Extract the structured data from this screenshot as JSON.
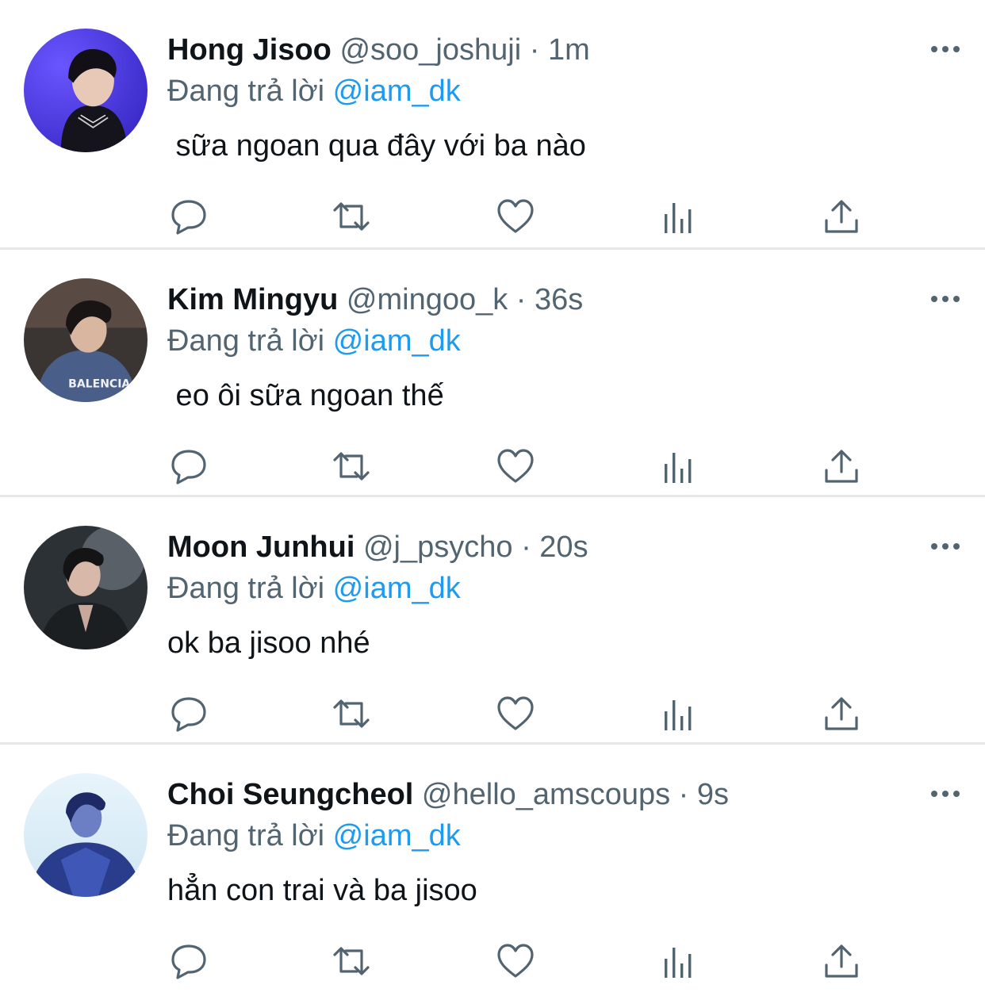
{
  "tweets": [
    {
      "name": "Hong Jisoo",
      "handle": "@soo_joshuji",
      "separator": "·",
      "time": "1m",
      "replying_prefix": "Đang trả lời",
      "replying_to": "@iam_dk",
      "text": " sữa ngoan qua đây với ba nào"
    },
    {
      "name": "Kim Mingyu",
      "handle": "@mingoo_k",
      "separator": "·",
      "time": "36s",
      "replying_prefix": "Đang trả lời",
      "replying_to": "@iam_dk",
      "text": " eo ôi sữa ngoan thế"
    },
    {
      "name": "Moon Junhui",
      "handle": "@j_psycho",
      "separator": "·",
      "time": "20s",
      "replying_prefix": "Đang trả lời",
      "replying_to": "@iam_dk",
      "text": "ok ba jisoo nhé"
    },
    {
      "name": "Choi Seungcheol",
      "handle": "@hello_amscoups",
      "separator": "·",
      "time": "9s",
      "replying_prefix": "Đang trả lời",
      "replying_to": "@iam_dk",
      "text": "hẳn con trai và ba jisoo"
    }
  ],
  "icons": {
    "reply": "reply-icon",
    "retweet": "retweet-icon",
    "like": "like-icon",
    "views": "views-icon",
    "share": "share-icon",
    "more": "more-icon"
  },
  "colors": {
    "text": "#0f1419",
    "secondary": "#536471",
    "mention": "#1d9bf0",
    "divider": "#e7e7e9"
  }
}
